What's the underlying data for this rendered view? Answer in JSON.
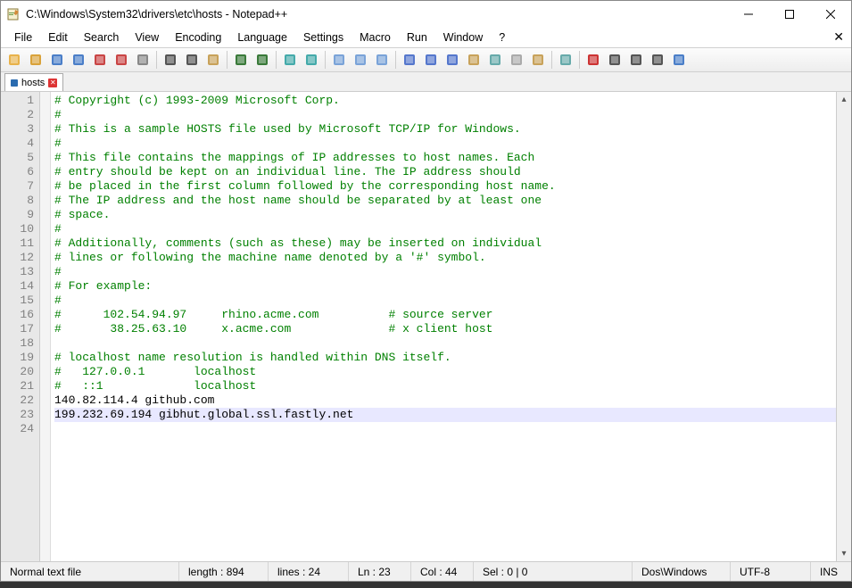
{
  "titlebar": {
    "title": "C:\\Windows\\System32\\drivers\\etc\\hosts - Notepad++"
  },
  "menu": {
    "file": "File",
    "edit": "Edit",
    "search": "Search",
    "view": "View",
    "encoding": "Encoding",
    "language": "Language",
    "settings": "Settings",
    "macro": "Macro",
    "run": "Run",
    "window": "Window",
    "help": "?"
  },
  "tab": {
    "filename": "hosts"
  },
  "editor": {
    "lines": [
      {
        "n": "1",
        "cls": "comment",
        "text": "# Copyright (c) 1993-2009 Microsoft Corp."
      },
      {
        "n": "2",
        "cls": "comment",
        "text": "#"
      },
      {
        "n": "3",
        "cls": "comment",
        "text": "# This is a sample HOSTS file used by Microsoft TCP/IP for Windows."
      },
      {
        "n": "4",
        "cls": "comment",
        "text": "#"
      },
      {
        "n": "5",
        "cls": "comment",
        "text": "# This file contains the mappings of IP addresses to host names. Each"
      },
      {
        "n": "6",
        "cls": "comment",
        "text": "# entry should be kept on an individual line. The IP address should"
      },
      {
        "n": "7",
        "cls": "comment",
        "text": "# be placed in the first column followed by the corresponding host name."
      },
      {
        "n": "8",
        "cls": "comment",
        "text": "# The IP address and the host name should be separated by at least one"
      },
      {
        "n": "9",
        "cls": "comment",
        "text": "# space."
      },
      {
        "n": "10",
        "cls": "comment",
        "text": "#"
      },
      {
        "n": "11",
        "cls": "comment",
        "text": "# Additionally, comments (such as these) may be inserted on individual"
      },
      {
        "n": "12",
        "cls": "comment",
        "text": "# lines or following the machine name denoted by a '#' symbol."
      },
      {
        "n": "13",
        "cls": "comment",
        "text": "#"
      },
      {
        "n": "14",
        "cls": "comment",
        "text": "# For example:"
      },
      {
        "n": "15",
        "cls": "comment",
        "text": "#"
      },
      {
        "n": "16",
        "cls": "comment",
        "text": "#      102.54.94.97     rhino.acme.com          # source server"
      },
      {
        "n": "17",
        "cls": "comment",
        "text": "#       38.25.63.10     x.acme.com              # x client host"
      },
      {
        "n": "18",
        "cls": "",
        "text": ""
      },
      {
        "n": "19",
        "cls": "comment",
        "text": "# localhost name resolution is handled within DNS itself."
      },
      {
        "n": "20",
        "cls": "comment",
        "text": "#   127.0.0.1       localhost"
      },
      {
        "n": "21",
        "cls": "comment",
        "text": "#   ::1             localhost"
      },
      {
        "n": "22",
        "cls": "",
        "text": "140.82.114.4 github.com"
      },
      {
        "n": "23",
        "cls": "active",
        "text": "199.232.69.194 gibhut.global.ssl.fastly.net"
      },
      {
        "n": "24",
        "cls": "",
        "text": ""
      }
    ]
  },
  "status": {
    "filetype": "Normal text file",
    "length": "length : 894",
    "lines": "lines : 24",
    "ln": "Ln : 23",
    "col": "Col : 44",
    "sel": "Sel : 0 | 0",
    "eol": "Dos\\Windows",
    "encoding": "UTF-8",
    "mode": "INS"
  },
  "toolbar_icons": [
    "new",
    "open",
    "save",
    "save-all",
    "close",
    "close-all",
    "print",
    "",
    "cut",
    "copy",
    "paste",
    "",
    "undo",
    "redo",
    "",
    "find",
    "replace",
    "",
    "zoom-in",
    "zoom-out",
    "sync",
    "",
    "wordwrap",
    "allchars",
    "indent-guide",
    "udl",
    "doc-map",
    "func-list",
    "folder",
    "",
    "monitor",
    "",
    "record",
    "stop",
    "play",
    "play-many",
    "save-macro"
  ],
  "toolbar_colors": {
    "new": "#e8b24a",
    "open": "#d9a23a",
    "save": "#4a7ec8",
    "save-all": "#4a7ec8",
    "close": "#c94545",
    "close-all": "#c94545",
    "print": "#888",
    "cut": "#555",
    "copy": "#555",
    "paste": "#c8a25a",
    "undo": "#3a7a3a",
    "redo": "#3a7a3a",
    "find": "#4aa",
    "replace": "#4aa",
    "zoom-in": "#7aa3d8",
    "zoom-out": "#7aa3d8",
    "sync": "#7aa3d8",
    "wordwrap": "#5577cc",
    "allchars": "#5577cc",
    "indent-guide": "#5577cc",
    "udl": "#c8a25a",
    "doc-map": "#6aa",
    "func-list": "#aaa",
    "folder": "#c8a25a",
    "monitor": "#6aa",
    "record": "#c33",
    "stop": "#555",
    "play": "#555",
    "play-many": "#555",
    "save-macro": "#4a7ec8"
  }
}
